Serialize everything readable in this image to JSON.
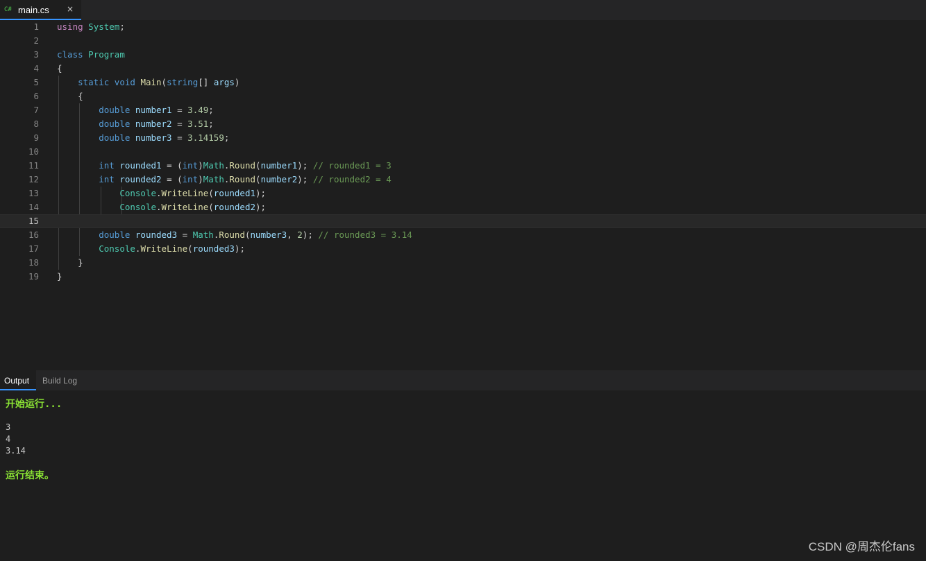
{
  "tab": {
    "icon_label": "C#",
    "title": "main.cs",
    "close_glyph": "×"
  },
  "editor": {
    "current_line": 15,
    "lines": [
      {
        "n": 1,
        "t": [
          [
            "kw-ctrl",
            "using"
          ],
          [
            "punc",
            " "
          ],
          [
            "type",
            "System"
          ],
          [
            "punc",
            ";"
          ]
        ]
      },
      {
        "n": 2,
        "t": []
      },
      {
        "n": 3,
        "t": [
          [
            "kw",
            "class"
          ],
          [
            "punc",
            " "
          ],
          [
            "type",
            "Program"
          ]
        ]
      },
      {
        "n": 4,
        "t": [
          [
            "punc",
            "{"
          ]
        ]
      },
      {
        "n": 5,
        "t": [
          [
            "punc",
            "    "
          ],
          [
            "kw",
            "static"
          ],
          [
            "punc",
            " "
          ],
          [
            "kw",
            "void"
          ],
          [
            "punc",
            " "
          ],
          [
            "fn",
            "Main"
          ],
          [
            "punc",
            "("
          ],
          [
            "kw",
            "string"
          ],
          [
            "punc",
            "[] "
          ],
          [
            "var",
            "args"
          ],
          [
            "punc",
            ")"
          ]
        ]
      },
      {
        "n": 6,
        "t": [
          [
            "punc",
            "    {"
          ]
        ]
      },
      {
        "n": 7,
        "t": [
          [
            "punc",
            "        "
          ],
          [
            "kw",
            "double"
          ],
          [
            "punc",
            " "
          ],
          [
            "var",
            "number1"
          ],
          [
            "punc",
            " = "
          ],
          [
            "num",
            "3.49"
          ],
          [
            "punc",
            ";"
          ]
        ]
      },
      {
        "n": 8,
        "t": [
          [
            "punc",
            "        "
          ],
          [
            "kw",
            "double"
          ],
          [
            "punc",
            " "
          ],
          [
            "var",
            "number2"
          ],
          [
            "punc",
            " = "
          ],
          [
            "num",
            "3.51"
          ],
          [
            "punc",
            ";"
          ]
        ]
      },
      {
        "n": 9,
        "t": [
          [
            "punc",
            "        "
          ],
          [
            "kw",
            "double"
          ],
          [
            "punc",
            " "
          ],
          [
            "var",
            "number3"
          ],
          [
            "punc",
            " = "
          ],
          [
            "num",
            "3.14159"
          ],
          [
            "punc",
            ";"
          ]
        ]
      },
      {
        "n": 10,
        "t": []
      },
      {
        "n": 11,
        "t": [
          [
            "punc",
            "        "
          ],
          [
            "kw",
            "int"
          ],
          [
            "punc",
            " "
          ],
          [
            "var",
            "rounded1"
          ],
          [
            "punc",
            " = ("
          ],
          [
            "kw",
            "int"
          ],
          [
            "punc",
            ")"
          ],
          [
            "type",
            "Math"
          ],
          [
            "punc",
            "."
          ],
          [
            "fn",
            "Round"
          ],
          [
            "punc",
            "("
          ],
          [
            "var",
            "number1"
          ],
          [
            "punc",
            "); "
          ],
          [
            "cmt",
            "// rounded1 = 3"
          ]
        ]
      },
      {
        "n": 12,
        "t": [
          [
            "punc",
            "        "
          ],
          [
            "kw",
            "int"
          ],
          [
            "punc",
            " "
          ],
          [
            "var",
            "rounded2"
          ],
          [
            "punc",
            " = ("
          ],
          [
            "kw",
            "int"
          ],
          [
            "punc",
            ")"
          ],
          [
            "type",
            "Math"
          ],
          [
            "punc",
            "."
          ],
          [
            "fn",
            "Round"
          ],
          [
            "punc",
            "("
          ],
          [
            "var",
            "number2"
          ],
          [
            "punc",
            "); "
          ],
          [
            "cmt",
            "// rounded2 = 4"
          ]
        ]
      },
      {
        "n": 13,
        "t": [
          [
            "punc",
            "            "
          ],
          [
            "type",
            "Console"
          ],
          [
            "punc",
            "."
          ],
          [
            "fn",
            "WriteLine"
          ],
          [
            "punc",
            "("
          ],
          [
            "var",
            "rounded1"
          ],
          [
            "punc",
            ");"
          ]
        ]
      },
      {
        "n": 14,
        "t": [
          [
            "punc",
            "            "
          ],
          [
            "type",
            "Console"
          ],
          [
            "punc",
            "."
          ],
          [
            "fn",
            "WriteLine"
          ],
          [
            "punc",
            "("
          ],
          [
            "var",
            "rounded2"
          ],
          [
            "punc",
            ");"
          ]
        ]
      },
      {
        "n": 15,
        "t": []
      },
      {
        "n": 16,
        "t": [
          [
            "punc",
            "        "
          ],
          [
            "kw",
            "double"
          ],
          [
            "punc",
            " "
          ],
          [
            "var",
            "rounded3"
          ],
          [
            "punc",
            " = "
          ],
          [
            "type",
            "Math"
          ],
          [
            "punc",
            "."
          ],
          [
            "fn",
            "Round"
          ],
          [
            "punc",
            "("
          ],
          [
            "var",
            "number3"
          ],
          [
            "punc",
            ", "
          ],
          [
            "num",
            "2"
          ],
          [
            "punc",
            "); "
          ],
          [
            "cmt",
            "// rounded3 = 3.14"
          ]
        ]
      },
      {
        "n": 17,
        "t": [
          [
            "punc",
            "        "
          ],
          [
            "type",
            "Console"
          ],
          [
            "punc",
            "."
          ],
          [
            "fn",
            "WriteLine"
          ],
          [
            "punc",
            "("
          ],
          [
            "var",
            "rounded3"
          ],
          [
            "punc",
            ");"
          ]
        ]
      },
      {
        "n": 18,
        "t": [
          [
            "punc",
            "    }"
          ]
        ]
      },
      {
        "n": 19,
        "t": [
          [
            "punc",
            "}"
          ]
        ]
      }
    ]
  },
  "panel": {
    "tabs": [
      {
        "label": "Output",
        "active": true
      },
      {
        "label": "Build Log",
        "active": false
      }
    ],
    "output": {
      "start_text": "开始运行...",
      "lines": [
        "3",
        "4",
        "3.14"
      ],
      "end_text": "运行结束。"
    }
  },
  "watermark": "CSDN @周杰伦fans",
  "colors": {
    "background": "#1e1e1e",
    "accent": "#3794ff",
    "status_green": "#8ae234"
  }
}
